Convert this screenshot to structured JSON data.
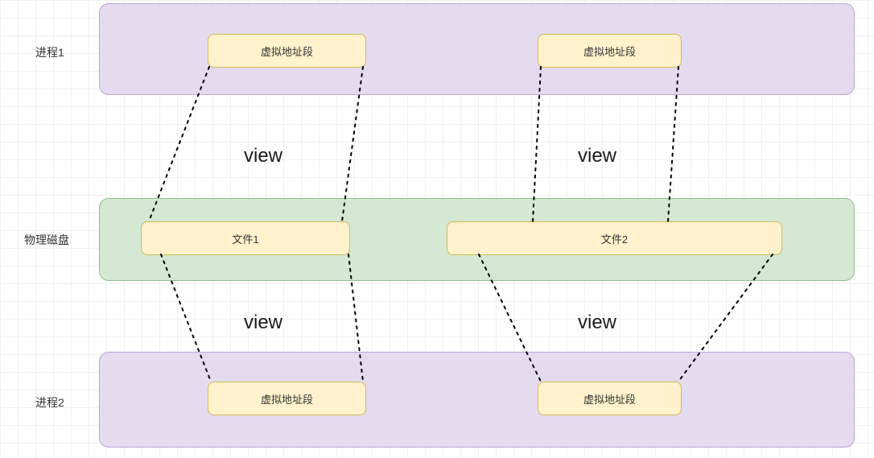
{
  "labels": {
    "process1": "进程1",
    "process2": "进程2",
    "physicalDisk": "物理磁盘",
    "virtualSegment": "虚拟地址段",
    "file1": "文件1",
    "file2": "文件2",
    "view": "view"
  },
  "diagram": {
    "description": "Memory-mapped file diagram showing two processes mapping virtual address segments to files on physical disk",
    "rows": [
      {
        "id": "process1",
        "type": "process",
        "items": [
          "virtualSegment",
          "virtualSegment"
        ]
      },
      {
        "id": "physicalDisk",
        "type": "disk",
        "items": [
          "file1",
          "file2"
        ]
      },
      {
        "id": "process2",
        "type": "process",
        "items": [
          "virtualSegment",
          "virtualSegment"
        ]
      }
    ],
    "mappings": [
      {
        "from": "process1.seg1",
        "to": "file1",
        "label": "view"
      },
      {
        "from": "process1.seg2",
        "to": "file2",
        "label": "view"
      },
      {
        "from": "process2.seg1",
        "to": "file1",
        "label": "view"
      },
      {
        "from": "process2.seg2",
        "to": "file2",
        "label": "view"
      }
    ]
  },
  "colors": {
    "process": "#E4DBEF",
    "disk": "#D4E8D4",
    "node": "#FFF2CC",
    "processBorder": "#B9A6D4",
    "diskBorder": "#8FBF8F",
    "nodeBorder": "#D6B656"
  }
}
